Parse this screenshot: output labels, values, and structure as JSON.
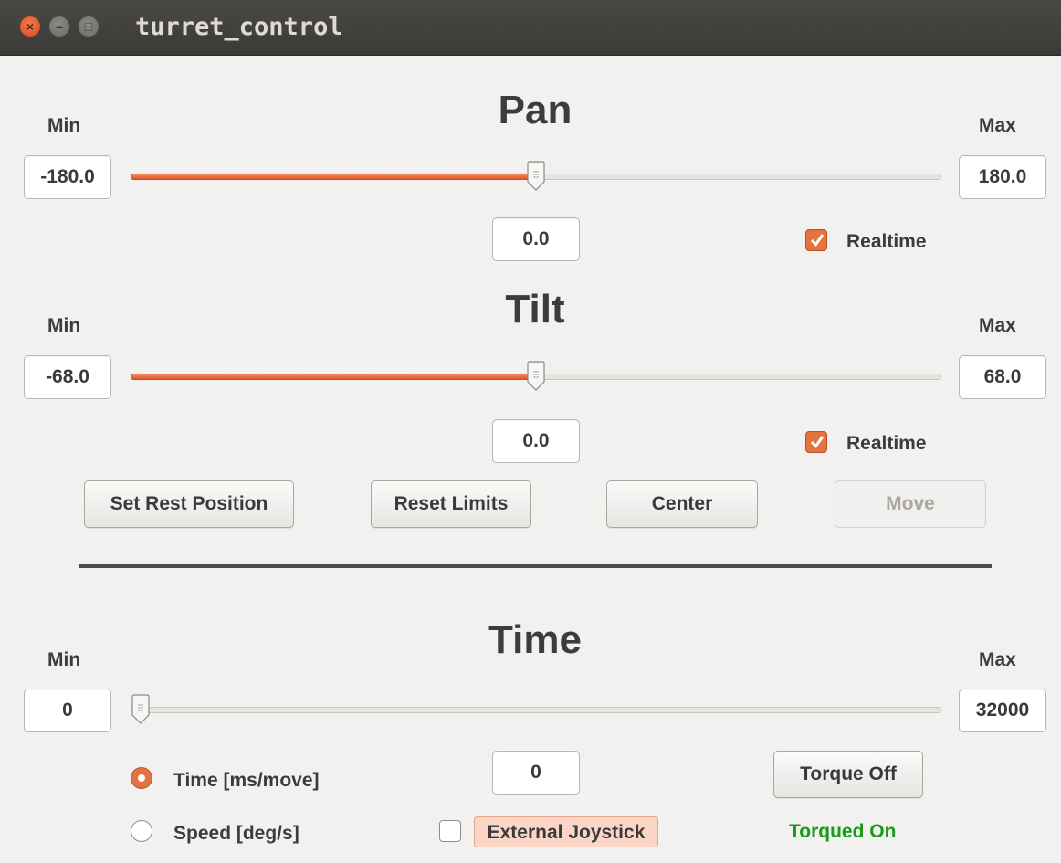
{
  "window": {
    "title": "turret_control"
  },
  "pan": {
    "title": "Pan",
    "min_label": "Min",
    "max_label": "Max",
    "min_value": "-180.0",
    "max_value": "180.0",
    "current_value": "0.0",
    "slider_fraction": 0.5,
    "realtime_label": "Realtime",
    "realtime_checked": true
  },
  "tilt": {
    "title": "Tilt",
    "min_label": "Min",
    "max_label": "Max",
    "min_value": "-68.0",
    "max_value": "68.0",
    "current_value": "0.0",
    "slider_fraction": 0.5,
    "realtime_label": "Realtime",
    "realtime_checked": true
  },
  "buttons": {
    "set_rest": "Set Rest Position",
    "reset_limits": "Reset Limits",
    "center": "Center",
    "move": "Move",
    "move_enabled": false
  },
  "time": {
    "title": "Time",
    "min_label": "Min",
    "max_label": "Max",
    "min_value": "0",
    "max_value": "32000",
    "current_value": "0",
    "slider_fraction": 0.0,
    "mode_time_label": "Time [ms/move]",
    "mode_speed_label": "Speed [deg/s]",
    "selected_mode": "time",
    "joystick_label": "External Joystick",
    "joystick_checked": false,
    "torque_button": "Torque Off",
    "torque_status": "Torqued On"
  },
  "colors": {
    "accent": "#e3743f",
    "status_ok": "#179b1a"
  }
}
